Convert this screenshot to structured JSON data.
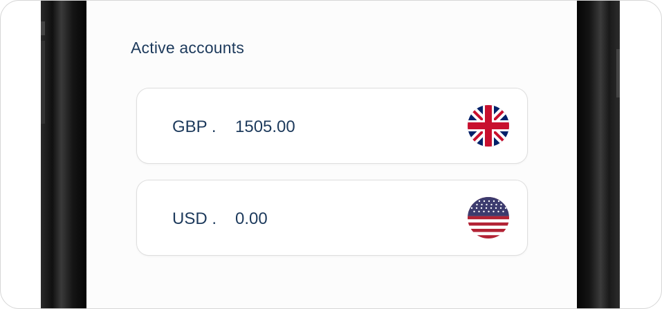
{
  "section": {
    "title": "Active accounts"
  },
  "accounts": [
    {
      "code": "GBP .",
      "amount": "1505.00",
      "flag_icon": "uk-flag-icon"
    },
    {
      "code": "USD .",
      "amount": "0.00",
      "flag_icon": "us-flag-icon"
    }
  ],
  "colors": {
    "text": "#1d3a5c",
    "card_border": "#dedede",
    "uk_blue": "#012169",
    "uk_red": "#c8102e",
    "us_blue": "#3c3b6e",
    "us_red": "#b22234"
  }
}
